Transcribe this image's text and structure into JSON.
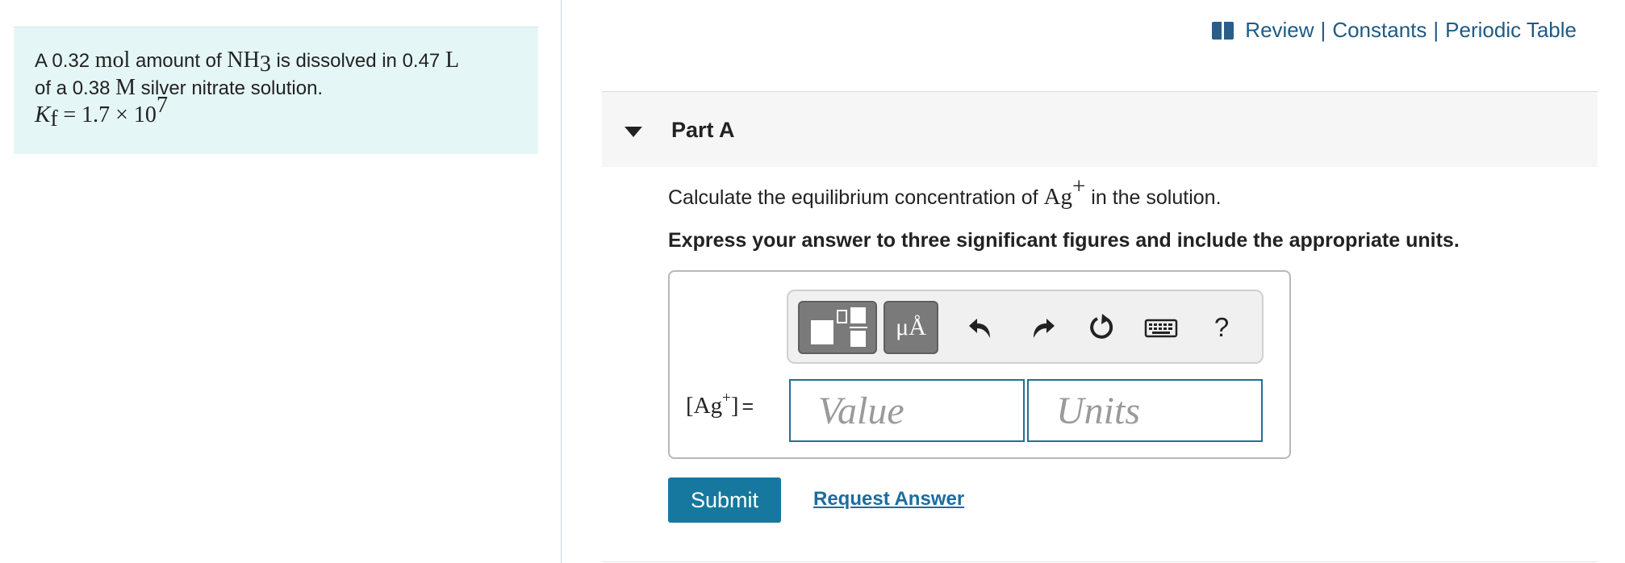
{
  "problem": {
    "line1": {
      "pre": "A 0.32 ",
      "mol": "mol",
      "mid": " amount of ",
      "nh": "NH",
      "sub": "3",
      "post": " is dissolved in 0.47 ",
      "L": "L"
    },
    "line2": {
      "pre": "of a 0.38 ",
      "M": "M",
      "post": " silver nitrate solution."
    },
    "kf": {
      "K": "K",
      "sub": "f",
      "rhs": "= 1.7 × 10",
      "exp": "7"
    }
  },
  "top_links": {
    "review": "Review",
    "separator": "|",
    "constants": "Constants",
    "periodic_table": "Periodic Table"
  },
  "part": {
    "title": "Part A"
  },
  "question": {
    "pre": "Calculate the equilibrium concentration of ",
    "ion": "Ag",
    "charge": "+",
    "post": " in the solution."
  },
  "instruction": "Express your answer to three significant figures and include the appropriate units.",
  "toolbar": {
    "units_label": "μÅ",
    "help_label": "?"
  },
  "answer": {
    "label_open": "[Ag",
    "label_charge": "+",
    "label_close": "]",
    "equals": "=",
    "value_placeholder": "Value",
    "units_placeholder": "Units"
  },
  "buttons": {
    "submit": "Submit",
    "request_answer": "Request Answer"
  },
  "colors": {
    "accent": "#16789e",
    "link": "#1f5a85",
    "problem_bg": "#e5f6f6"
  }
}
